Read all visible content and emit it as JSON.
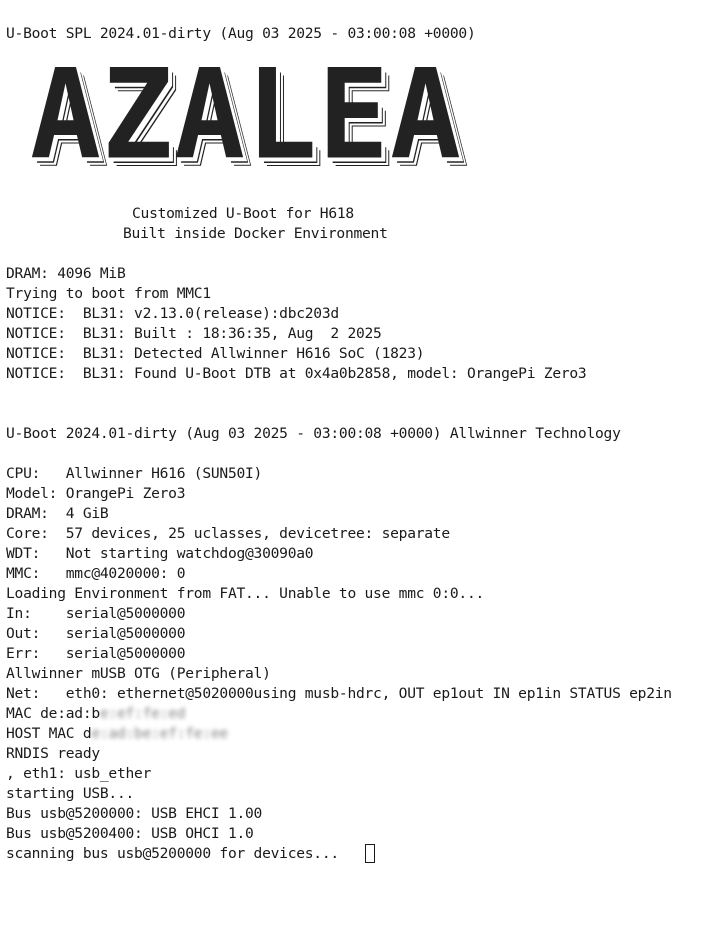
{
  "banner": {
    "letters": [
      "A",
      "Z",
      "A",
      "L",
      "E",
      "A"
    ]
  },
  "console": {
    "spl_header": "U-Boot SPL 2024.01-dirty (Aug 03 2025 - 03:00:08 +0000)",
    "subtitle_1": "Customized U-Boot for H618",
    "subtitle_2": "Built inside Docker Environment",
    "dram_spl": "DRAM: 4096 MiB",
    "boot_from": "Trying to boot from MMC1",
    "notice_1": "NOTICE:  BL31: v2.13.0(release):dbc203d",
    "notice_2": "NOTICE:  BL31: Built : 18:36:35, Aug  2 2025",
    "notice_3": "NOTICE:  BL31: Detected Allwinner H616 SoC (1823)",
    "notice_4": "NOTICE:  BL31: Found U-Boot DTB at 0x4a0b2858, model: OrangePi Zero3",
    "uboot_header": "U-Boot 2024.01-dirty (Aug 03 2025 - 03:00:08 +0000) Allwinner Technology",
    "cpu": "CPU:   Allwinner H616 (SUN50I)",
    "model": "Model: OrangePi Zero3",
    "dram": "DRAM:  4 GiB",
    "core": "Core:  57 devices, 25 uclasses, devicetree: separate",
    "wdt": "WDT:   Not starting watchdog@30090a0",
    "mmc": "MMC:   mmc@4020000: 0",
    "env": "Loading Environment from FAT... Unable to use mmc 0:0...",
    "in": "In:    serial@5000000",
    "out": "Out:   serial@5000000",
    "err": "Err:   serial@5000000",
    "musb": "Allwinner mUSB OTG (Peripheral)",
    "net": "Net:   eth0: ethernet@5020000using musb-hdrc, OUT ep1out IN ep1in STATUS ep2in",
    "mac_prefix": "MAC de:ad:b",
    "mac_redacted": "e:ef:fe:ed",
    "host_mac_prefix": "HOST MAC d",
    "host_mac_redacted": "e:ad:be:ef:fe:ee",
    "rndis": "RNDIS ready",
    "eth1": ", eth1: usb_ether",
    "usb_start": "starting USB...",
    "ehci": "Bus usb@5200000: USB EHCI 1.00",
    "ohci": "Bus usb@5200400: USB OHCI 1.0",
    "scanning": "scanning bus usb@5200000 for devices... "
  }
}
